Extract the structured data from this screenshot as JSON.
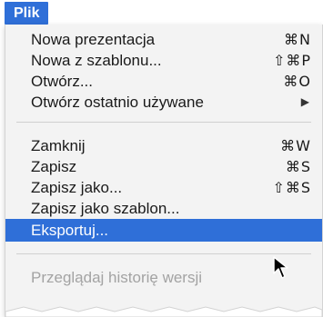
{
  "menubar": {
    "title": "Plik"
  },
  "menu": {
    "groups": [
      [
        {
          "label": "Nowa prezentacja",
          "shortcut": "⌘N"
        },
        {
          "label": "Nowa z szablonu...",
          "shortcut": "⇧⌘P"
        },
        {
          "label": "Otwórz...",
          "shortcut": "⌘O"
        },
        {
          "label": "Otwórz ostatnio używane",
          "shortcut": "▶"
        }
      ],
      [
        {
          "label": "Zamknij",
          "shortcut": "⌘W"
        },
        {
          "label": "Zapisz",
          "shortcut": "⌘S"
        },
        {
          "label": "Zapisz jako...",
          "shortcut": "⇧⌘S"
        },
        {
          "label": "Zapisz jako szablon...",
          "shortcut": ""
        },
        {
          "label": "Eksportuj...",
          "shortcut": ""
        }
      ],
      [
        {
          "label": "Przeglądaj historię wersji",
          "shortcut": ""
        }
      ]
    ]
  },
  "state": {
    "highlighted_item": "Eksportuj...",
    "disabled_item": "Przeglądaj historię wersji"
  },
  "colors": {
    "highlight": "#2f6fd8",
    "menu_background": "#f3f3f3",
    "text": "#1a1a1a",
    "disabled_text": "#a3a3a3"
  },
  "icons": {
    "cursor": "arrow-cursor-icon",
    "submenu": "submenu-arrow-icon"
  }
}
